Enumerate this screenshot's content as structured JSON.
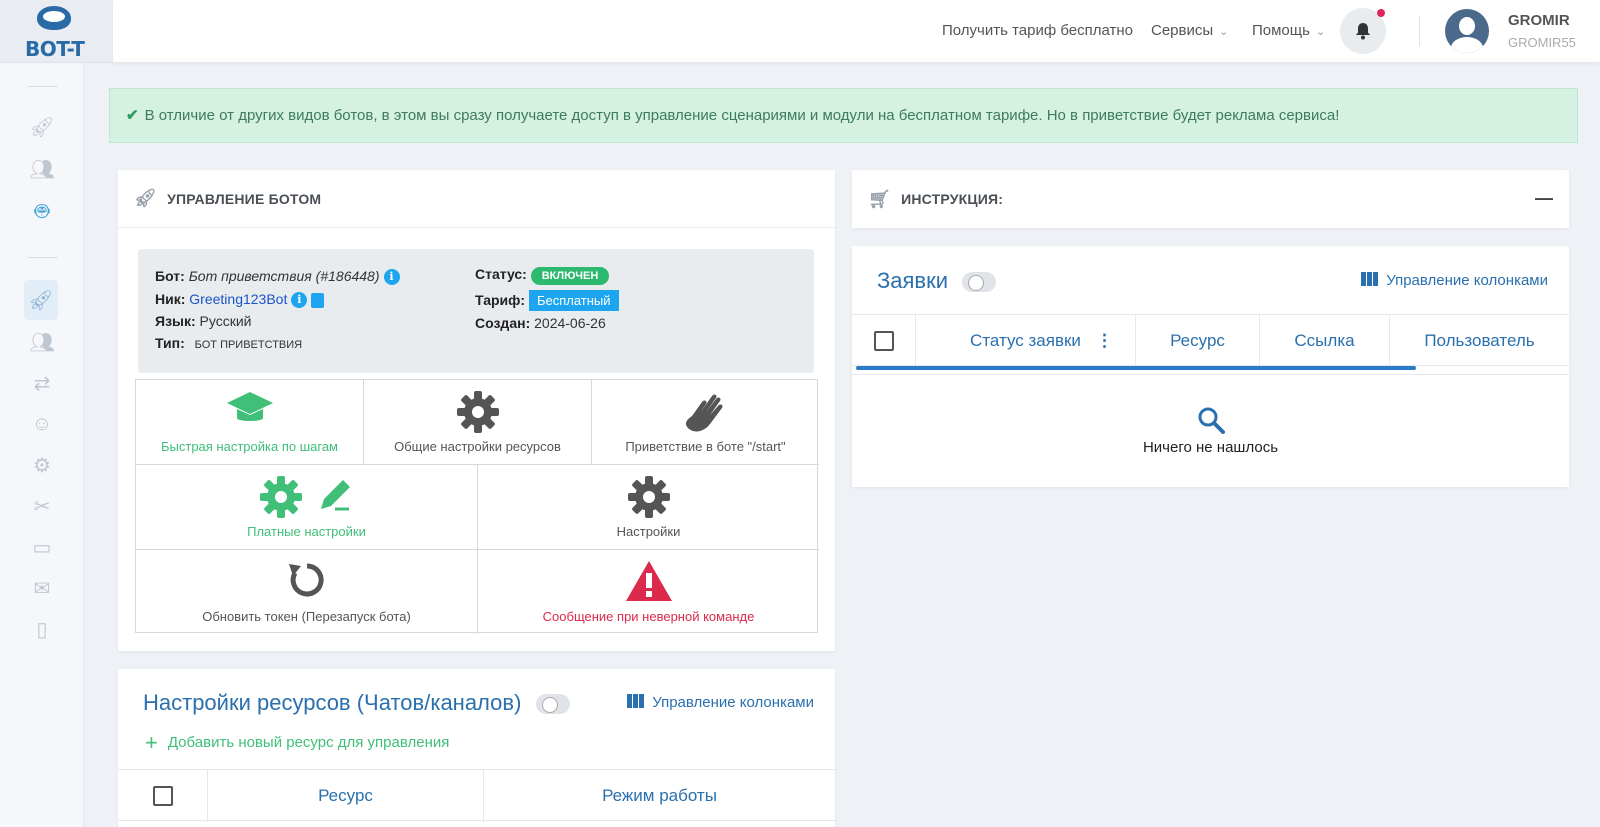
{
  "logo": {
    "text": "BOT-T"
  },
  "header": {
    "free_plan_link": "Получить тариф бесплатно",
    "services_label": "Сервисы",
    "help_label": "Помощь",
    "user_name": "GROMIR",
    "user_login": "GROMIR55"
  },
  "alert": {
    "text": "В отличие от других видов ботов, в этом вы сразу получаете доступ в управление сценариями и модули на бесплатном тарифе. Но в приветствие будет реклама сервиса!"
  },
  "bot_panel": {
    "title": "УПРАВЛЕНИЕ БОТОМ",
    "bot_label": "Бот:",
    "bot_value": "Бот приветствия (#186448)",
    "nick_label": "Ник:",
    "nick_value": "Greeting123Bot",
    "lang_label": "Язык:",
    "lang_value": "Русский",
    "type_label": "Тип:",
    "type_value": "БОТ ПРИВЕТСТВИЯ",
    "status_label": "Статус:",
    "status_value": "ВКЛЮЧЕН",
    "plan_label": "Тариф:",
    "plan_value": "Бесплатный",
    "created_label": "Создан:",
    "created_value": "2024-06-26",
    "tiles": [
      {
        "label": "Быстрая настройка по шагам",
        "icon": "graduation-cap-icon"
      },
      {
        "label": "Общие настройки ресурсов",
        "icon": "gear-icon"
      },
      {
        "label": "Приветствие в боте \"/start\"",
        "icon": "wave-hand-icon"
      },
      {
        "label": "Платные настройки",
        "icon": "gear-pencil-icon"
      },
      {
        "label": "Настройки",
        "icon": "gear-icon"
      },
      {
        "label": "Обновить токен (Перезапуск бота)",
        "icon": "refresh-icon"
      },
      {
        "label": "Сообщение при неверной команде",
        "icon": "warning-icon"
      }
    ]
  },
  "instructions": {
    "title": "ИНСТРУКЦИЯ:",
    "collapse_symbol": "—"
  },
  "requests": {
    "title": "Заявки",
    "columns_manager": "Управление колонками",
    "columns": [
      "Статус заявки",
      "Ресурс",
      "Ссылка",
      "Пользователь"
    ],
    "empty_text": "Ничего не нашлось"
  },
  "resources": {
    "title": "Настройки ресурсов (Чатов/каналов)",
    "columns_manager": "Управление колонками",
    "add_link": "Добавить новый ресурс для управления",
    "columns": [
      "Ресурс",
      "Режим работы"
    ]
  },
  "colors": {
    "accent": "#2a6fae",
    "green": "#3fbf77",
    "red": "#dc2a4c",
    "info_blue": "#1ea5f0"
  }
}
